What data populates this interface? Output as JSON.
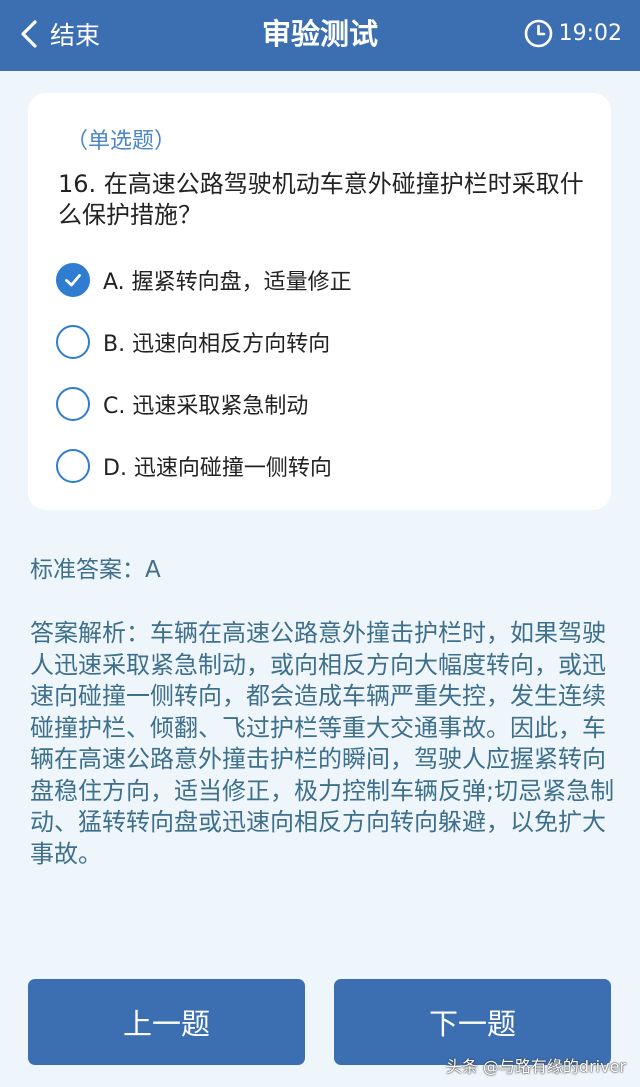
{
  "header": {
    "back_label": "结束",
    "title": "审验测试",
    "time": "19:02"
  },
  "question": {
    "type": "（单选题）",
    "text": "16. 在高速公路驾驶机动车意外碰撞护栏时采取什么保护措施？",
    "options": [
      {
        "label": "A. 握紧转向盘，适量修正",
        "selected": true
      },
      {
        "label": "B. 迅速向相反方向转向",
        "selected": false
      },
      {
        "label": "C. 迅速采取紧急制动",
        "selected": false
      },
      {
        "label": "D. 迅速向碰撞一侧转向",
        "selected": false
      }
    ]
  },
  "answer": {
    "standard": "标准答案：A",
    "analysis": "答案解析：车辆在高速公路意外撞击护栏时，如果驾驶人迅速采取紧急制动，或向相反方向大幅度转向，或迅速向碰撞一侧转向，都会造成车辆严重失控，发生连续碰撞护栏、倾翻、飞过护栏等重大交通事故。因此，车辆在高速公路意外撞击护栏的瞬间，驾驶人应握紧转向盘稳住方向，适当修正，极力控制车辆反弹;切忌紧急制动、猛转转向盘或迅速向相反方向转向躲避，以免扩大事故。"
  },
  "nav": {
    "prev_label": "上一题",
    "next_label": "下一题"
  },
  "watermark": "头条 @与路有缘的driver",
  "colors": {
    "header": "#3c6fb2",
    "accent": "#2f7cd1",
    "background": "#eef6fc",
    "analysis_text": "#3e6f8b"
  }
}
